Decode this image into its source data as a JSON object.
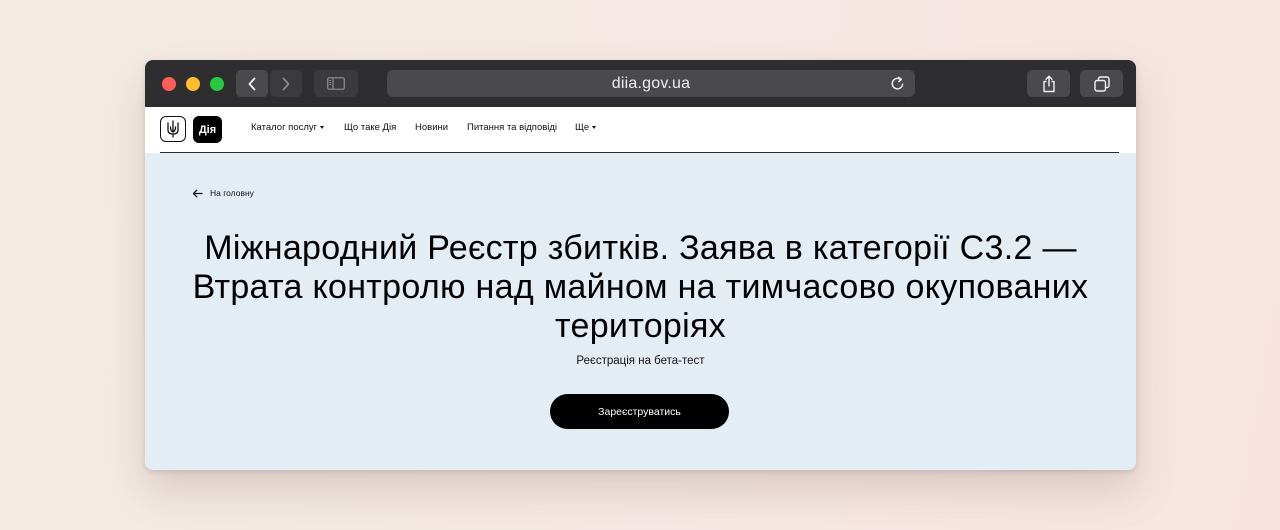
{
  "browser": {
    "url": "diia.gov.ua",
    "traffic_lights": {
      "close": "#fe5f57",
      "minimize": "#febc2e",
      "zoom": "#28c840"
    }
  },
  "header": {
    "logo_text": "Дія",
    "nav": [
      {
        "label": "Каталог послуг",
        "has_dropdown": true
      },
      {
        "label": "Що таке Дія",
        "has_dropdown": false
      },
      {
        "label": "Новини",
        "has_dropdown": false
      },
      {
        "label": "Питання та відповіді",
        "has_dropdown": false
      },
      {
        "label": "Ще",
        "has_dropdown": true
      }
    ]
  },
  "main": {
    "back_label": "На головну",
    "title": "Міжнародний Реєстр збитків. Заява в категорії С3.2 — Втрата контролю над майном на тимчасово окупованих територіях",
    "subtitle": "Реєстрація на бета-тест",
    "cta_label": "Зареєструватись"
  },
  "colors": {
    "page_bg": "#e4ecf4",
    "toolbar_bg": "#2e2e30",
    "button_bg": "#000000"
  }
}
